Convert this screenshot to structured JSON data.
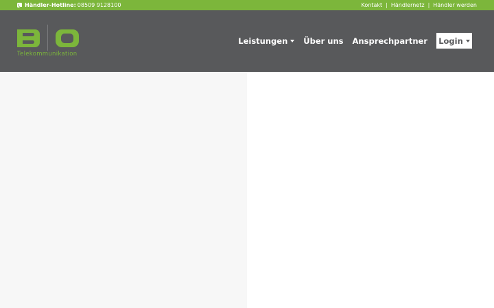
{
  "topbar": {
    "hotline_label": "Händler-Hotline:",
    "hotline_number": "08509 9128100",
    "links": [
      "Kontakt",
      "Händlernetz",
      "Händler werden"
    ],
    "separator": "|"
  },
  "logo": {
    "letter_left": "B",
    "letter_right": "O",
    "tagline": "Telekommunikation"
  },
  "nav": {
    "items": [
      {
        "label": "Leistungen",
        "has_dropdown": true
      },
      {
        "label": "Über uns",
        "has_dropdown": false
      },
      {
        "label": "Ansprechpartner",
        "has_dropdown": false
      }
    ],
    "login_label": "Login"
  },
  "colors": {
    "brand_green": "#7cb63b",
    "header_gray": "#58595b",
    "panel_light": "#f7f7f7"
  }
}
